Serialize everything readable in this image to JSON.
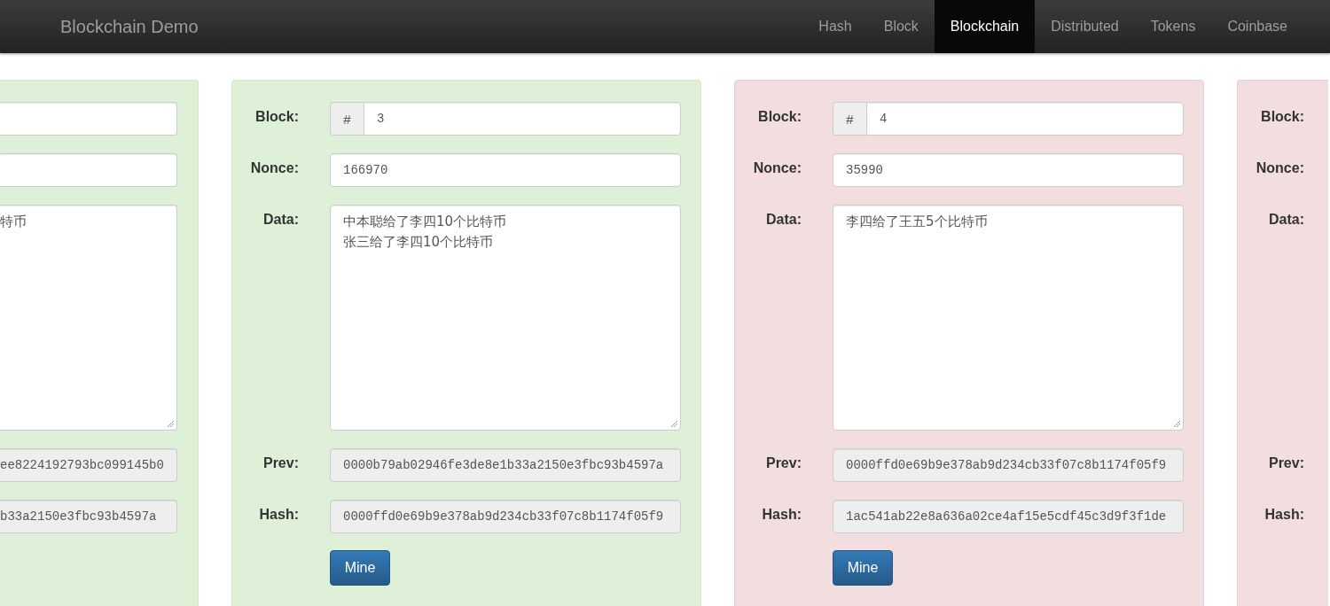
{
  "navbar": {
    "brand": "Blockchain Demo",
    "items": [
      {
        "label": "Hash",
        "selected": false
      },
      {
        "label": "Block",
        "selected": false
      },
      {
        "label": "Blockchain",
        "selected": true
      },
      {
        "label": "Distributed",
        "selected": false
      },
      {
        "label": "Tokens",
        "selected": false
      },
      {
        "label": "Coinbase",
        "selected": false
      }
    ]
  },
  "blocks": [
    {
      "valid": true,
      "fields": [
        {
          "kind": "block"
        },
        {
          "kind": "nonce"
        },
        {
          "kind": "data",
          "lines": [
            "特币"
          ]
        },
        {
          "kind": "prev",
          "value": "ee8224192793bc099145b0"
        },
        {
          "kind": "hash",
          "value": "b33a2150e3fbc93b4597a"
        }
      ]
    },
    {
      "valid": true,
      "fields": [
        {
          "kind": "block",
          "label": "Block:",
          "prefix": "#",
          "value": "3"
        },
        {
          "kind": "nonce",
          "label": "Nonce:",
          "value": "166970"
        },
        {
          "kind": "data",
          "label": "Data:",
          "lines": [
            "中本聪给了李四10个比特币",
            "张三给了李四10个比特币"
          ]
        },
        {
          "kind": "prev",
          "label": "Prev:",
          "value": "0000b79ab02946fe3de8e1b33a2150e3fbc93b4597a"
        },
        {
          "kind": "hash",
          "label": "Hash:",
          "value": "0000ffd0e69b9e378ab9d234cb33f07c8b1174f05f9"
        }
      ],
      "button": "Mine"
    },
    {
      "valid": false,
      "fields": [
        {
          "kind": "block",
          "label": "Block:",
          "prefix": "#",
          "value": "4"
        },
        {
          "kind": "nonce",
          "label": "Nonce:",
          "value": "35990"
        },
        {
          "kind": "data",
          "label": "Data:",
          "lines": [
            "李四给了王五5个比特币"
          ]
        },
        {
          "kind": "prev",
          "label": "Prev:",
          "value": "0000ffd0e69b9e378ab9d234cb33f07c8b1174f05f9"
        },
        {
          "kind": "hash",
          "label": "Hash:",
          "value": "1ac541ab22e8a636a02ce4af15e5cdf45c3d9f3f1de"
        }
      ],
      "button": "Mine"
    },
    {
      "valid": false,
      "fields": [
        {
          "kind": "block",
          "label": "Block:"
        },
        {
          "kind": "nonce",
          "label": "Nonce:"
        },
        {
          "kind": "data",
          "label": "Data:"
        },
        {
          "kind": "prev",
          "label": "Prev:"
        },
        {
          "kind": "hash",
          "label": "Hash:"
        }
      ]
    }
  ]
}
